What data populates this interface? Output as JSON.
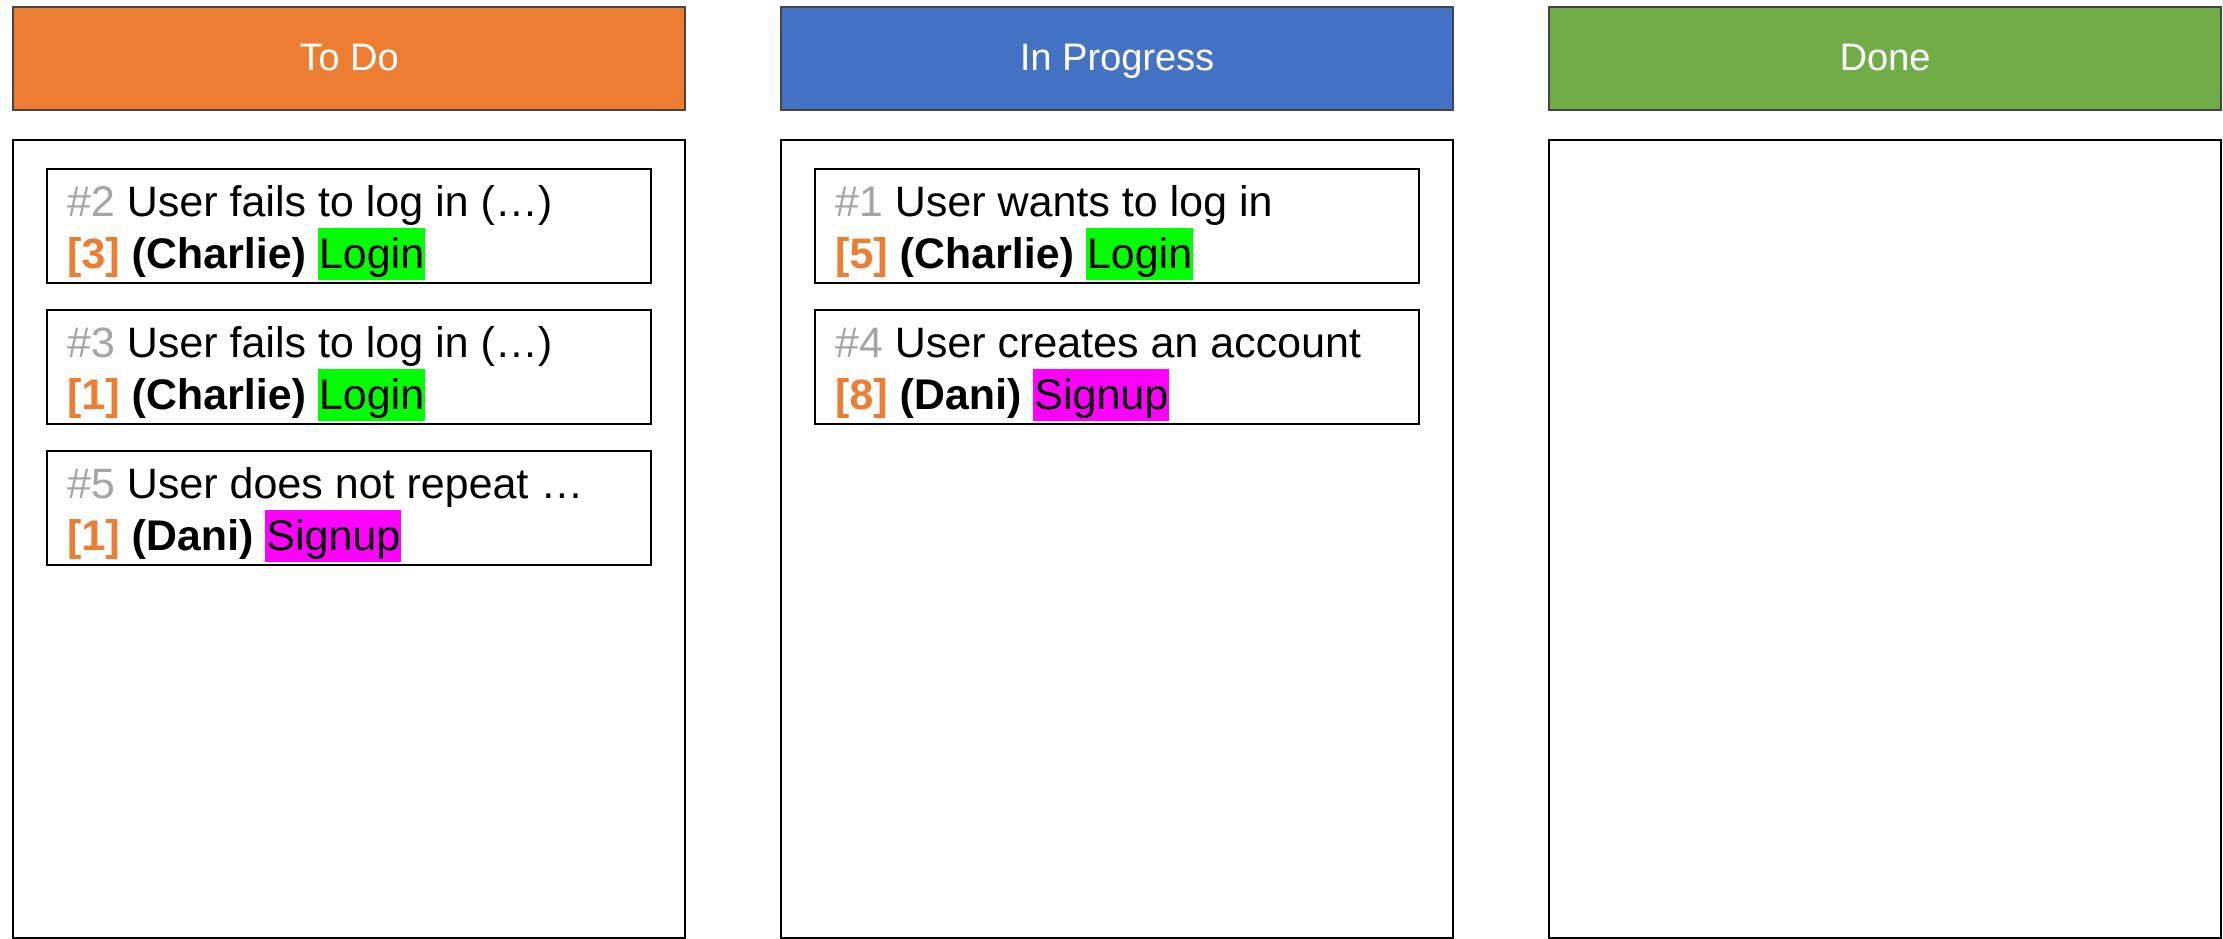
{
  "colors": {
    "todo": "#ed7d31",
    "in_progress": "#4472c4",
    "done": "#70ad47",
    "label_login": "#00ff00",
    "label_signup": "#ff00ff"
  },
  "columns": [
    {
      "title": "To Do",
      "cards": [
        {
          "id": "#2",
          "title": "User fails to log in (…)",
          "points": "[3]",
          "assignee": "(Charlie)",
          "label": "Login"
        },
        {
          "id": "#3",
          "title": "User fails to log in (…)",
          "points": "[1]",
          "assignee": "(Charlie)",
          "label": "Login"
        },
        {
          "id": "#5",
          "title": "User does not repeat …",
          "points": "[1]",
          "assignee": "(Dani)",
          "label": "Signup"
        }
      ]
    },
    {
      "title": "In Progress",
      "cards": [
        {
          "id": "#1",
          "title": "User wants to log in",
          "points": "[5]",
          "assignee": "(Charlie)",
          "label": "Login"
        },
        {
          "id": "#4",
          "title": "User creates an account",
          "points": "[8]",
          "assignee": "(Dani)",
          "label": "Signup"
        }
      ]
    },
    {
      "title": "Done",
      "cards": []
    }
  ]
}
